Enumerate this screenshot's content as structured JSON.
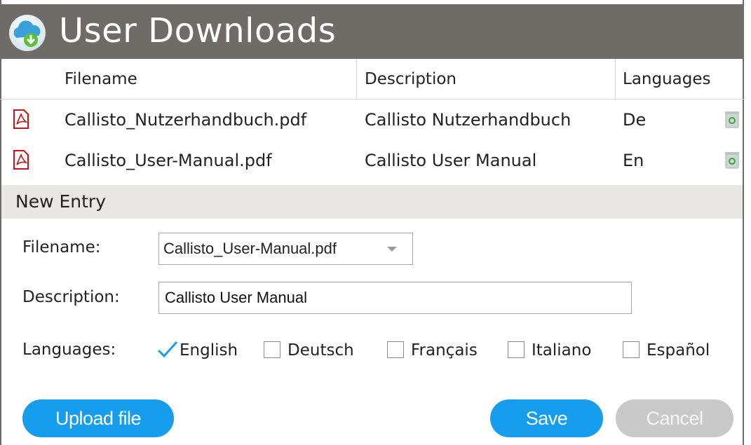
{
  "header": {
    "title": "User Downloads",
    "icon": "cloud-download-icon"
  },
  "table": {
    "columns": [
      "Filename",
      "Description",
      "Languages"
    ],
    "rows": [
      {
        "filename": "Callisto_Nutzerhandbuch.pdf",
        "description": "Callisto Nutzerhandbuch",
        "language": "De"
      },
      {
        "filename": "Callisto_User-Manual.pdf",
        "description": "Callisto User Manual",
        "language": "En"
      }
    ]
  },
  "new_entry": {
    "section_title": "New Entry",
    "filename_label": "Filename:",
    "filename_value": "Callisto_User-Manual.pdf",
    "description_label": "Description:",
    "description_value": "Callisto User Manual",
    "languages_label": "Languages:",
    "languages": [
      {
        "label": "English",
        "checked": true
      },
      {
        "label": "Deutsch",
        "checked": false
      },
      {
        "label": "Français",
        "checked": false
      },
      {
        "label": "Italiano",
        "checked": false
      },
      {
        "label": "Español",
        "checked": false
      }
    ]
  },
  "buttons": {
    "upload": "Upload file",
    "save": "Save",
    "cancel": "Cancel"
  },
  "colors": {
    "header_bg": "#6f6b67",
    "accent": "#169ded",
    "disabled": "#c9c9c9",
    "section_bg": "#e8e7e3"
  }
}
